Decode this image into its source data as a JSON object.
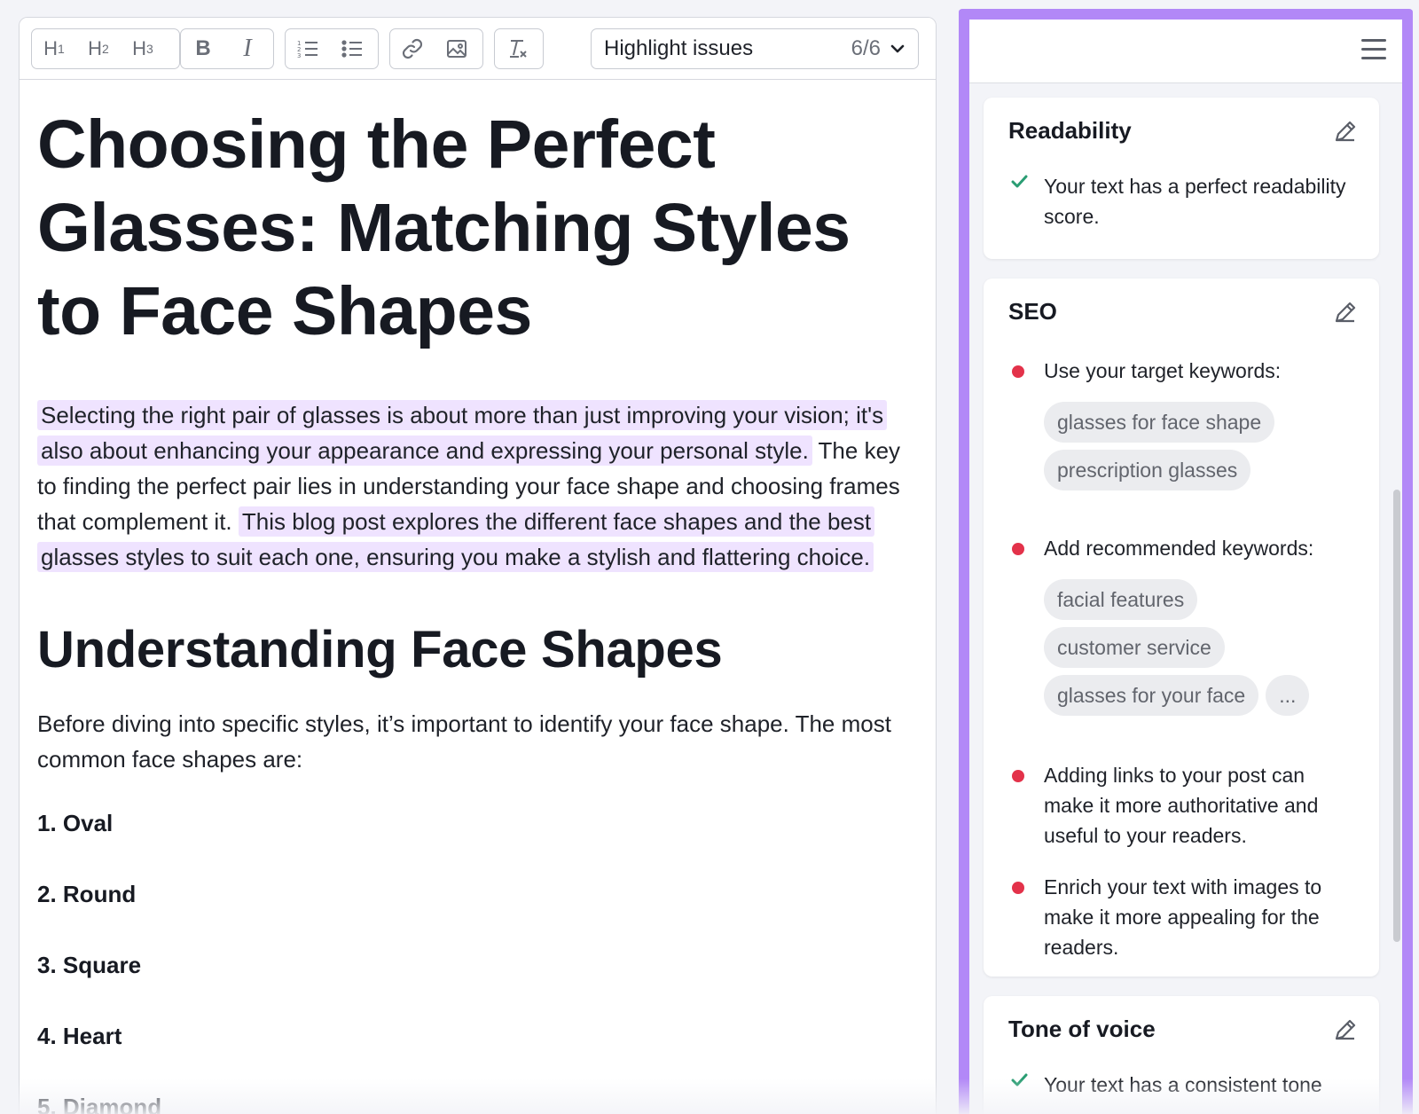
{
  "toolbar": {
    "headings": [
      {
        "label": "H",
        "sub": "1"
      },
      {
        "label": "H",
        "sub": "2"
      },
      {
        "label": "H",
        "sub": "3"
      }
    ],
    "bold": "B",
    "italic": "I",
    "highlight": {
      "label": "Highlight issues",
      "count": "6/6"
    }
  },
  "article": {
    "title": "Choosing the Perfect Glasses: Matching Styles to Face Shapes",
    "intro": {
      "hl1": "Selecting the right pair of glasses is about more than just improving your vision; it's also about enhancing your appearance and expressing your personal style.",
      "plain": " The key to finding the perfect pair lies in understanding your face shape and choosing frames that complement it. ",
      "hl2": "This blog post explores the different face shapes and the best glasses styles to suit each one, ensuring you make a stylish and flattering choice."
    },
    "section_heading": "Understanding Face Shapes",
    "section_text": "Before diving into specific styles, it’s important to identify your face shape. The most common face shapes are:",
    "shapes": [
      "1. Oval",
      "2. Round",
      "3. Square",
      "4. Heart",
      "5. Diamond"
    ]
  },
  "panel": {
    "readability": {
      "title": "Readability",
      "message": "Your text has a perfect readability score."
    },
    "seo": {
      "title": "SEO",
      "target_label": "Use your target keywords:",
      "target_keywords": [
        "glasses for face shape",
        "prescription glasses"
      ],
      "recommended_label": "Add recommended keywords:",
      "recommended_keywords": [
        "facial features",
        "customer service",
        "glasses for your face"
      ],
      "more": "...",
      "links_tip": "Adding links to your post can make it more authoritative and useful to your readers.",
      "images_tip": "Enrich your text with images to make it more appealing for the readers."
    },
    "tone": {
      "title": "Tone of voice",
      "message": "Your text has a consistent tone"
    }
  },
  "colors": {
    "accent_border": "#b288f7",
    "highlight_bg": "#efe3ff",
    "issue_dot": "#e3324a",
    "check_green": "#2a9d73"
  }
}
